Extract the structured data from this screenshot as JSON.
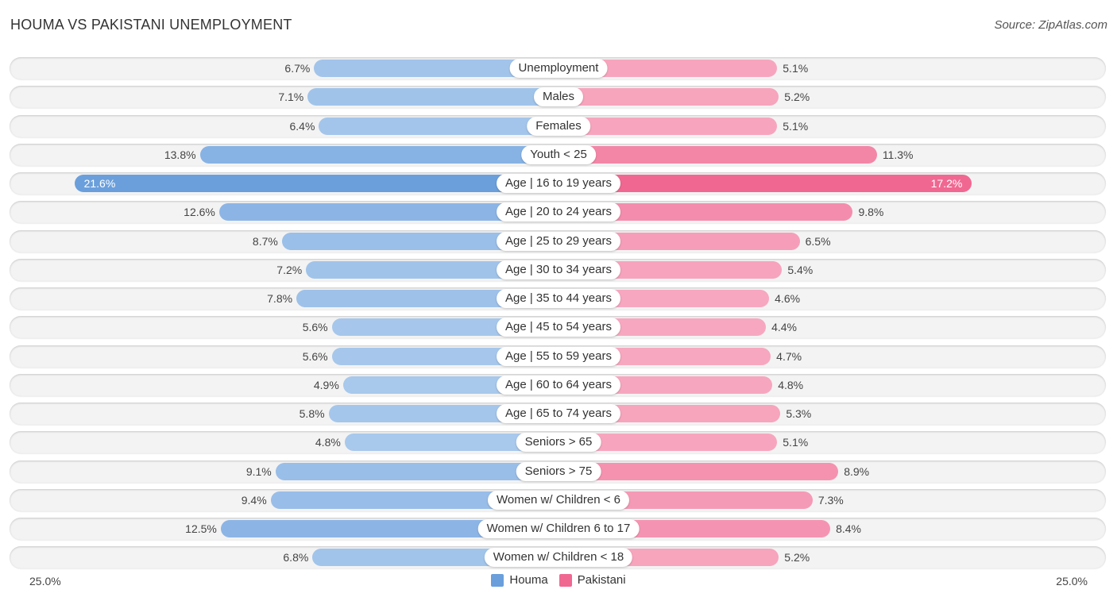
{
  "title": "HOUMA VS PAKISTANI UNEMPLOYMENT",
  "source": "Source: ZipAtlas.com",
  "colors": {
    "houma_strong": "#6a9fdc",
    "houma_light": "#a8c8ec",
    "pakistani_strong": "#f06892",
    "pakistani_light": "#f7a8c0"
  },
  "chart_data": {
    "type": "bar",
    "orientation": "horizontal-diverging",
    "title": "HOUMA VS PAKISTANI UNEMPLOYMENT",
    "xlabel": "",
    "ylabel": "",
    "xlim": [
      -25.0,
      25.0
    ],
    "axis_labels": {
      "left": "25.0%",
      "right": "25.0%"
    },
    "legend": {
      "position": "bottom-center",
      "entries": [
        "Houma",
        "Pakistani"
      ]
    },
    "categories": [
      "Unemployment",
      "Males",
      "Females",
      "Youth < 25",
      "Age | 16 to 19 years",
      "Age | 20 to 24 years",
      "Age | 25 to 29 years",
      "Age | 30 to 34 years",
      "Age | 35 to 44 years",
      "Age | 45 to 54 years",
      "Age | 55 to 59 years",
      "Age | 60 to 64 years",
      "Age | 65 to 74 years",
      "Seniors > 65",
      "Seniors > 75",
      "Women w/ Children < 6",
      "Women w/ Children 6 to 17",
      "Women w/ Children < 18"
    ],
    "series": [
      {
        "name": "Houma",
        "side": "left",
        "values": [
          6.7,
          7.1,
          6.4,
          13.8,
          21.6,
          12.6,
          8.7,
          7.2,
          7.8,
          5.6,
          5.6,
          4.9,
          5.8,
          4.8,
          9.1,
          9.4,
          12.5,
          6.8
        ]
      },
      {
        "name": "Pakistani",
        "side": "right",
        "values": [
          5.1,
          5.2,
          5.1,
          11.3,
          17.2,
          9.8,
          6.5,
          5.4,
          4.6,
          4.4,
          4.7,
          4.8,
          5.3,
          5.1,
          8.9,
          7.3,
          8.4,
          5.2
        ]
      }
    ],
    "value_format": "{v}%"
  }
}
